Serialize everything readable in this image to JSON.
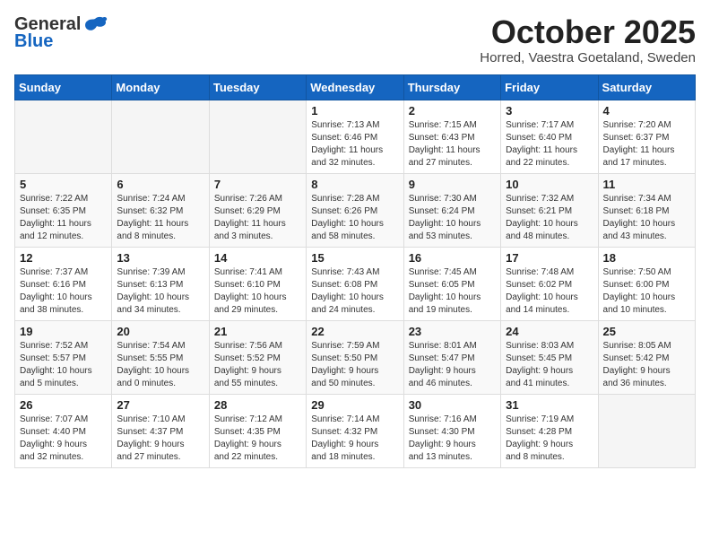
{
  "header": {
    "logo_general": "General",
    "logo_blue": "Blue",
    "month": "October 2025",
    "location": "Horred, Vaestra Goetaland, Sweden"
  },
  "weekdays": [
    "Sunday",
    "Monday",
    "Tuesday",
    "Wednesday",
    "Thursday",
    "Friday",
    "Saturday"
  ],
  "weeks": [
    [
      {
        "day": "",
        "info": ""
      },
      {
        "day": "",
        "info": ""
      },
      {
        "day": "",
        "info": ""
      },
      {
        "day": "1",
        "info": "Sunrise: 7:13 AM\nSunset: 6:46 PM\nDaylight: 11 hours\nand 32 minutes."
      },
      {
        "day": "2",
        "info": "Sunrise: 7:15 AM\nSunset: 6:43 PM\nDaylight: 11 hours\nand 27 minutes."
      },
      {
        "day": "3",
        "info": "Sunrise: 7:17 AM\nSunset: 6:40 PM\nDaylight: 11 hours\nand 22 minutes."
      },
      {
        "day": "4",
        "info": "Sunrise: 7:20 AM\nSunset: 6:37 PM\nDaylight: 11 hours\nand 17 minutes."
      }
    ],
    [
      {
        "day": "5",
        "info": "Sunrise: 7:22 AM\nSunset: 6:35 PM\nDaylight: 11 hours\nand 12 minutes."
      },
      {
        "day": "6",
        "info": "Sunrise: 7:24 AM\nSunset: 6:32 PM\nDaylight: 11 hours\nand 8 minutes."
      },
      {
        "day": "7",
        "info": "Sunrise: 7:26 AM\nSunset: 6:29 PM\nDaylight: 11 hours\nand 3 minutes."
      },
      {
        "day": "8",
        "info": "Sunrise: 7:28 AM\nSunset: 6:26 PM\nDaylight: 10 hours\nand 58 minutes."
      },
      {
        "day": "9",
        "info": "Sunrise: 7:30 AM\nSunset: 6:24 PM\nDaylight: 10 hours\nand 53 minutes."
      },
      {
        "day": "10",
        "info": "Sunrise: 7:32 AM\nSunset: 6:21 PM\nDaylight: 10 hours\nand 48 minutes."
      },
      {
        "day": "11",
        "info": "Sunrise: 7:34 AM\nSunset: 6:18 PM\nDaylight: 10 hours\nand 43 minutes."
      }
    ],
    [
      {
        "day": "12",
        "info": "Sunrise: 7:37 AM\nSunset: 6:16 PM\nDaylight: 10 hours\nand 38 minutes."
      },
      {
        "day": "13",
        "info": "Sunrise: 7:39 AM\nSunset: 6:13 PM\nDaylight: 10 hours\nand 34 minutes."
      },
      {
        "day": "14",
        "info": "Sunrise: 7:41 AM\nSunset: 6:10 PM\nDaylight: 10 hours\nand 29 minutes."
      },
      {
        "day": "15",
        "info": "Sunrise: 7:43 AM\nSunset: 6:08 PM\nDaylight: 10 hours\nand 24 minutes."
      },
      {
        "day": "16",
        "info": "Sunrise: 7:45 AM\nSunset: 6:05 PM\nDaylight: 10 hours\nand 19 minutes."
      },
      {
        "day": "17",
        "info": "Sunrise: 7:48 AM\nSunset: 6:02 PM\nDaylight: 10 hours\nand 14 minutes."
      },
      {
        "day": "18",
        "info": "Sunrise: 7:50 AM\nSunset: 6:00 PM\nDaylight: 10 hours\nand 10 minutes."
      }
    ],
    [
      {
        "day": "19",
        "info": "Sunrise: 7:52 AM\nSunset: 5:57 PM\nDaylight: 10 hours\nand 5 minutes."
      },
      {
        "day": "20",
        "info": "Sunrise: 7:54 AM\nSunset: 5:55 PM\nDaylight: 10 hours\nand 0 minutes."
      },
      {
        "day": "21",
        "info": "Sunrise: 7:56 AM\nSunset: 5:52 PM\nDaylight: 9 hours\nand 55 minutes."
      },
      {
        "day": "22",
        "info": "Sunrise: 7:59 AM\nSunset: 5:50 PM\nDaylight: 9 hours\nand 50 minutes."
      },
      {
        "day": "23",
        "info": "Sunrise: 8:01 AM\nSunset: 5:47 PM\nDaylight: 9 hours\nand 46 minutes."
      },
      {
        "day": "24",
        "info": "Sunrise: 8:03 AM\nSunset: 5:45 PM\nDaylight: 9 hours\nand 41 minutes."
      },
      {
        "day": "25",
        "info": "Sunrise: 8:05 AM\nSunset: 5:42 PM\nDaylight: 9 hours\nand 36 minutes."
      }
    ],
    [
      {
        "day": "26",
        "info": "Sunrise: 7:07 AM\nSunset: 4:40 PM\nDaylight: 9 hours\nand 32 minutes."
      },
      {
        "day": "27",
        "info": "Sunrise: 7:10 AM\nSunset: 4:37 PM\nDaylight: 9 hours\nand 27 minutes."
      },
      {
        "day": "28",
        "info": "Sunrise: 7:12 AM\nSunset: 4:35 PM\nDaylight: 9 hours\nand 22 minutes."
      },
      {
        "day": "29",
        "info": "Sunrise: 7:14 AM\nSunset: 4:32 PM\nDaylight: 9 hours\nand 18 minutes."
      },
      {
        "day": "30",
        "info": "Sunrise: 7:16 AM\nSunset: 4:30 PM\nDaylight: 9 hours\nand 13 minutes."
      },
      {
        "day": "31",
        "info": "Sunrise: 7:19 AM\nSunset: 4:28 PM\nDaylight: 9 hours\nand 8 minutes."
      },
      {
        "day": "",
        "info": ""
      }
    ]
  ]
}
